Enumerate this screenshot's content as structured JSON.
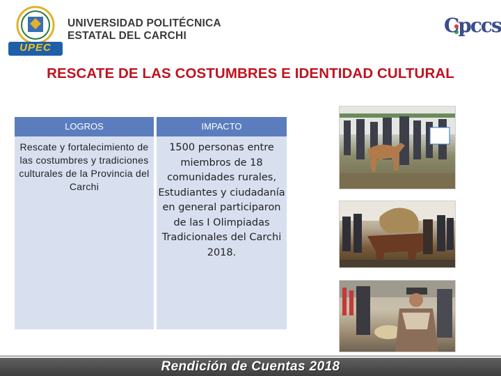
{
  "header": {
    "university_line1": "UNIVERSIDAD POLITÉCNICA",
    "university_line2": "ESTATAL DEL CARCHI",
    "logo_text": "UPEC",
    "cpccs_logo_text": "Cpccs"
  },
  "title": "RESCATE DE LAS COSTUMBRES E IDENTIDAD CULTURAL",
  "table": {
    "headers": [
      "LOGROS",
      "IMPACTO"
    ],
    "rows": [
      {
        "logros": "Rescate y fortalecimiento de las costumbres y tradiciones culturales de la Provincia del Carchi",
        "impacto": "1500 personas entre miembros de 18 comunidades rurales, Estudiantes y ciudadanía en general participaron de las I Olimpiadas Tradicionales del Carchi 2018."
      }
    ]
  },
  "photos": [
    "event-photo-horse",
    "event-photo-parade",
    "event-photo-women"
  ],
  "footer": {
    "text": "Rendición de Cuentas 2018"
  },
  "colors": {
    "title_red": "#c0121f",
    "table_header_blue": "#5b7dbe",
    "table_body": "#d8e0f0",
    "footer_gray": "#4a4a4a"
  }
}
